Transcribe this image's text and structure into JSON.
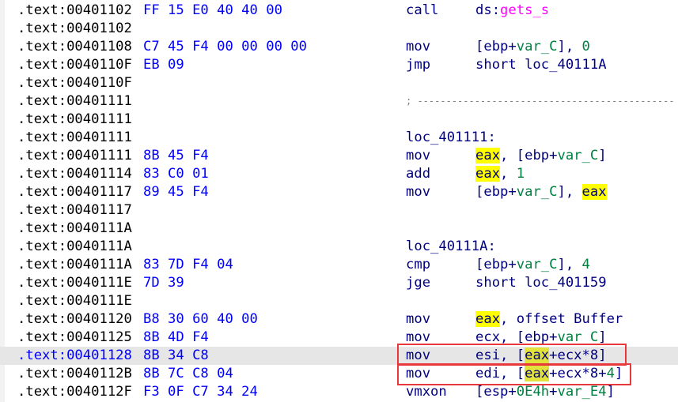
{
  "colors": {
    "address": "#000000",
    "bytes": "#0000ff",
    "mnemonic": "#000080",
    "variable": "#008040",
    "function": "#ff00ff",
    "highlight": "#ffff00",
    "selection": "#e6e6e6",
    "annotation_box": "#e8383c"
  },
  "selected_row": 19,
  "boxed_rows": [
    19,
    20
  ],
  "rows": [
    {
      "addr": ".text:00401102",
      "bytes": "FF 15 E0 40 40 00",
      "mnem": "call",
      "ops": [
        {
          "t": "ds:",
          "k": "r"
        },
        {
          "t": "gets_s",
          "k": "f"
        }
      ]
    },
    {
      "addr": ".text:00401102"
    },
    {
      "addr": ".text:00401108",
      "bytes": "C7 45 F4 00 00 00 00",
      "mnem": "mov",
      "ops": [
        {
          "t": "[ebp+",
          "k": "r"
        },
        {
          "t": "var_C",
          "k": "v"
        },
        {
          "t": "], ",
          "k": "r"
        },
        {
          "t": "0",
          "k": "n"
        }
      ]
    },
    {
      "addr": ".text:0040110F",
      "bytes": "EB 09",
      "mnem": "jmp",
      "ops": [
        {
          "t": "short loc_40111A",
          "k": "r"
        }
      ]
    },
    {
      "addr": ".text:0040110F"
    },
    {
      "addr": ".text:00401111",
      "comment": "; ---------------------------------------------"
    },
    {
      "addr": ".text:00401111"
    },
    {
      "addr": ".text:00401111",
      "label": "loc_401111:"
    },
    {
      "addr": ".text:00401111",
      "bytes": "8B 45 F4",
      "mnem": "mov",
      "ops": [
        {
          "t": "eax",
          "k": "h"
        },
        {
          "t": ", [ebp+",
          "k": "r"
        },
        {
          "t": "var_C",
          "k": "v"
        },
        {
          "t": "]",
          "k": "r"
        }
      ]
    },
    {
      "addr": ".text:00401114",
      "bytes": "83 C0 01",
      "mnem": "add",
      "ops": [
        {
          "t": "eax",
          "k": "h"
        },
        {
          "t": ", ",
          "k": "r"
        },
        {
          "t": "1",
          "k": "n"
        }
      ]
    },
    {
      "addr": ".text:00401117",
      "bytes": "89 45 F4",
      "mnem": "mov",
      "ops": [
        {
          "t": "[ebp+",
          "k": "r"
        },
        {
          "t": "var_C",
          "k": "v"
        },
        {
          "t": "], ",
          "k": "r"
        },
        {
          "t": "eax",
          "k": "h"
        }
      ]
    },
    {
      "addr": ".text:00401117"
    },
    {
      "addr": ".text:0040111A"
    },
    {
      "addr": ".text:0040111A",
      "label": "loc_40111A:"
    },
    {
      "addr": ".text:0040111A",
      "bytes": "83 7D F4 04",
      "mnem": "cmp",
      "ops": [
        {
          "t": "[ebp+",
          "k": "r"
        },
        {
          "t": "var_C",
          "k": "v"
        },
        {
          "t": "], ",
          "k": "r"
        },
        {
          "t": "4",
          "k": "n"
        }
      ]
    },
    {
      "addr": ".text:0040111E",
      "bytes": "7D 39",
      "mnem": "jge",
      "ops": [
        {
          "t": "short loc_401159",
          "k": "r"
        }
      ]
    },
    {
      "addr": ".text:0040111E"
    },
    {
      "addr": ".text:00401120",
      "bytes": "B8 30 60 40 00",
      "mnem": "mov",
      "ops": [
        {
          "t": "eax",
          "k": "h"
        },
        {
          "t": ", offset Buffer",
          "k": "r"
        }
      ]
    },
    {
      "addr": ".text:00401125",
      "bytes": "8B 4D F4",
      "mnem": "mov",
      "ops": [
        {
          "t": "ecx, [ebp+",
          "k": "r"
        },
        {
          "t": "var_C",
          "k": "v"
        },
        {
          "t": "]",
          "k": "r"
        }
      ]
    },
    {
      "addr": ".text:00401128",
      "bytes": "8B 34 C8",
      "mnem": "mov",
      "ops": [
        {
          "t": "esi, [",
          "k": "r"
        },
        {
          "t": "eax",
          "k": "h"
        },
        {
          "t": "+ecx*8]",
          "k": "r"
        }
      ]
    },
    {
      "addr": ".text:0040112B",
      "bytes": "8B 7C C8 04",
      "mnem": "mov",
      "ops": [
        {
          "t": "edi, [",
          "k": "r"
        },
        {
          "t": "eax",
          "k": "h"
        },
        {
          "t": "+ecx*8+",
          "k": "r"
        },
        {
          "t": "4",
          "k": "n"
        },
        {
          "t": "]",
          "k": "r"
        }
      ]
    },
    {
      "addr": ".text:0040112F",
      "bytes": "F3 0F C7 34 24",
      "mnem": "vmxon",
      "ops": [
        {
          "t": "[esp+",
          "k": "r"
        },
        {
          "t": "0E4h",
          "k": "n"
        },
        {
          "t": "+",
          "k": "r"
        },
        {
          "t": "var_E4",
          "k": "v"
        },
        {
          "t": "]",
          "k": "r"
        }
      ]
    }
  ]
}
